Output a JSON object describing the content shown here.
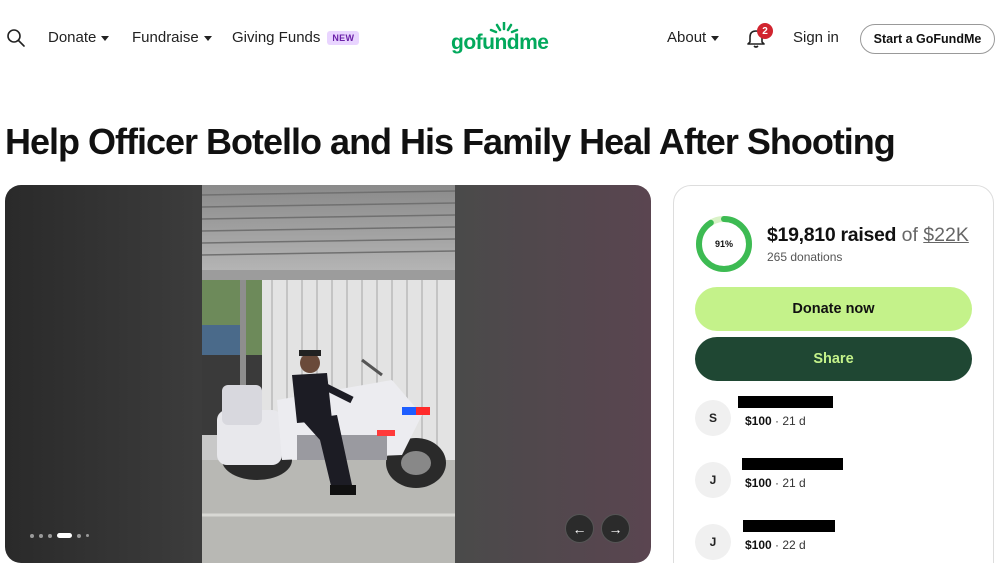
{
  "header": {
    "nav": [
      {
        "label": "Donate"
      },
      {
        "label": "Fundraise"
      },
      {
        "label": "Giving Funds",
        "badge": "NEW"
      }
    ],
    "logo_text": "gofundme",
    "about_label": "About",
    "notification_count": "2",
    "signin_label": "Sign in",
    "start_label": "Start a GoFundMe"
  },
  "campaign": {
    "title": "Help Officer Botello and His Family Heal After Shooting",
    "percent_label": "91%",
    "percent_value": 0.91,
    "raised": "$19,810 raised",
    "of_text": "of",
    "goal": "$22K",
    "donations": "265 donations",
    "donate_label": "Donate now",
    "share_label": "Share"
  },
  "media": {
    "slide_count": 6,
    "active_slide": 4,
    "prev_icon": "←",
    "next_icon": "→"
  },
  "donors": [
    {
      "initial": "S",
      "amount": "$100",
      "time": "21 d"
    },
    {
      "initial": "J",
      "amount": "$100",
      "time": "21 d"
    },
    {
      "initial": "J",
      "amount": "$100",
      "time": "22 d"
    }
  ],
  "colors": {
    "brand_green": "#02a95c",
    "donate_bg": "#c4f28a",
    "share_bg": "#1f4733",
    "notif_red": "#d1242f"
  }
}
